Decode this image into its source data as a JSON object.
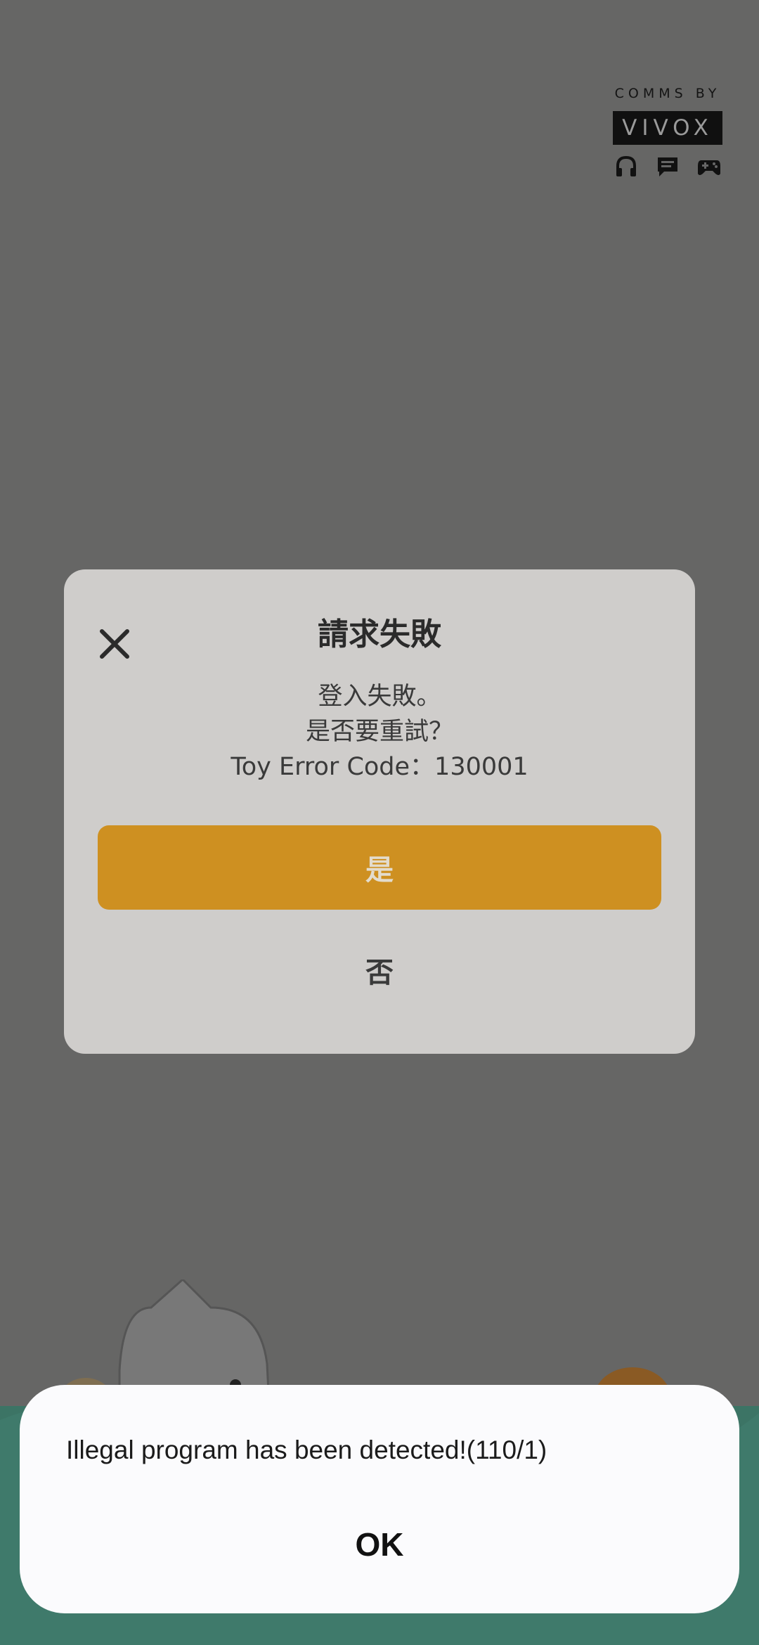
{
  "vivox": {
    "top_text": "COMMS BY",
    "brand": "VIVOX",
    "icons": [
      "headset-icon",
      "chat-icon",
      "gamepad-icon"
    ]
  },
  "dialog": {
    "title": "請求失敗",
    "message_lines": [
      "登入失敗。",
      "是否要重試？",
      "Toy Error Code：130001"
    ],
    "yes_label": "是",
    "no_label": "否",
    "close_icon": "close-icon"
  },
  "alert": {
    "message": "Illegal program has been detected!(110/1)",
    "ok_label": "OK"
  },
  "colors": {
    "overlay": "#666665",
    "dialog_bg": "#cfcdcb",
    "accent_button": "#ce9021",
    "alert_bg": "#fbfbfd"
  }
}
